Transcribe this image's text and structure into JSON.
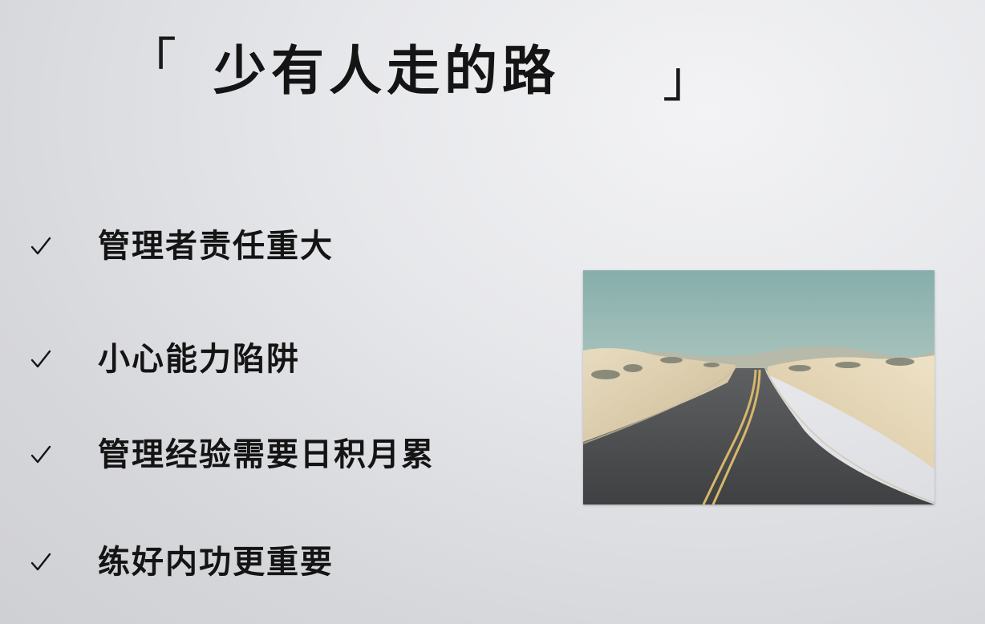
{
  "slide": {
    "title": {
      "open_bracket": "「",
      "text": "少有人走的路",
      "close_bracket": "」"
    },
    "bullets": [
      {
        "icon": "check-icon",
        "text": "管理者责任重大"
      },
      {
        "icon": "check-icon",
        "text": "小心能力陷阱"
      },
      {
        "icon": "check-icon",
        "text": "管理经验需要日积月累"
      },
      {
        "icon": "check-icon",
        "text": "练好内功更重要"
      }
    ],
    "image": {
      "subject": "desert-road-photo"
    }
  },
  "colors": {
    "text": "#141414",
    "background": "#e2e3e6",
    "sky": "#8fb6b3",
    "sand": "#e3d4b3",
    "asphalt": "#4e5052",
    "road_line": "#d9b96a"
  }
}
